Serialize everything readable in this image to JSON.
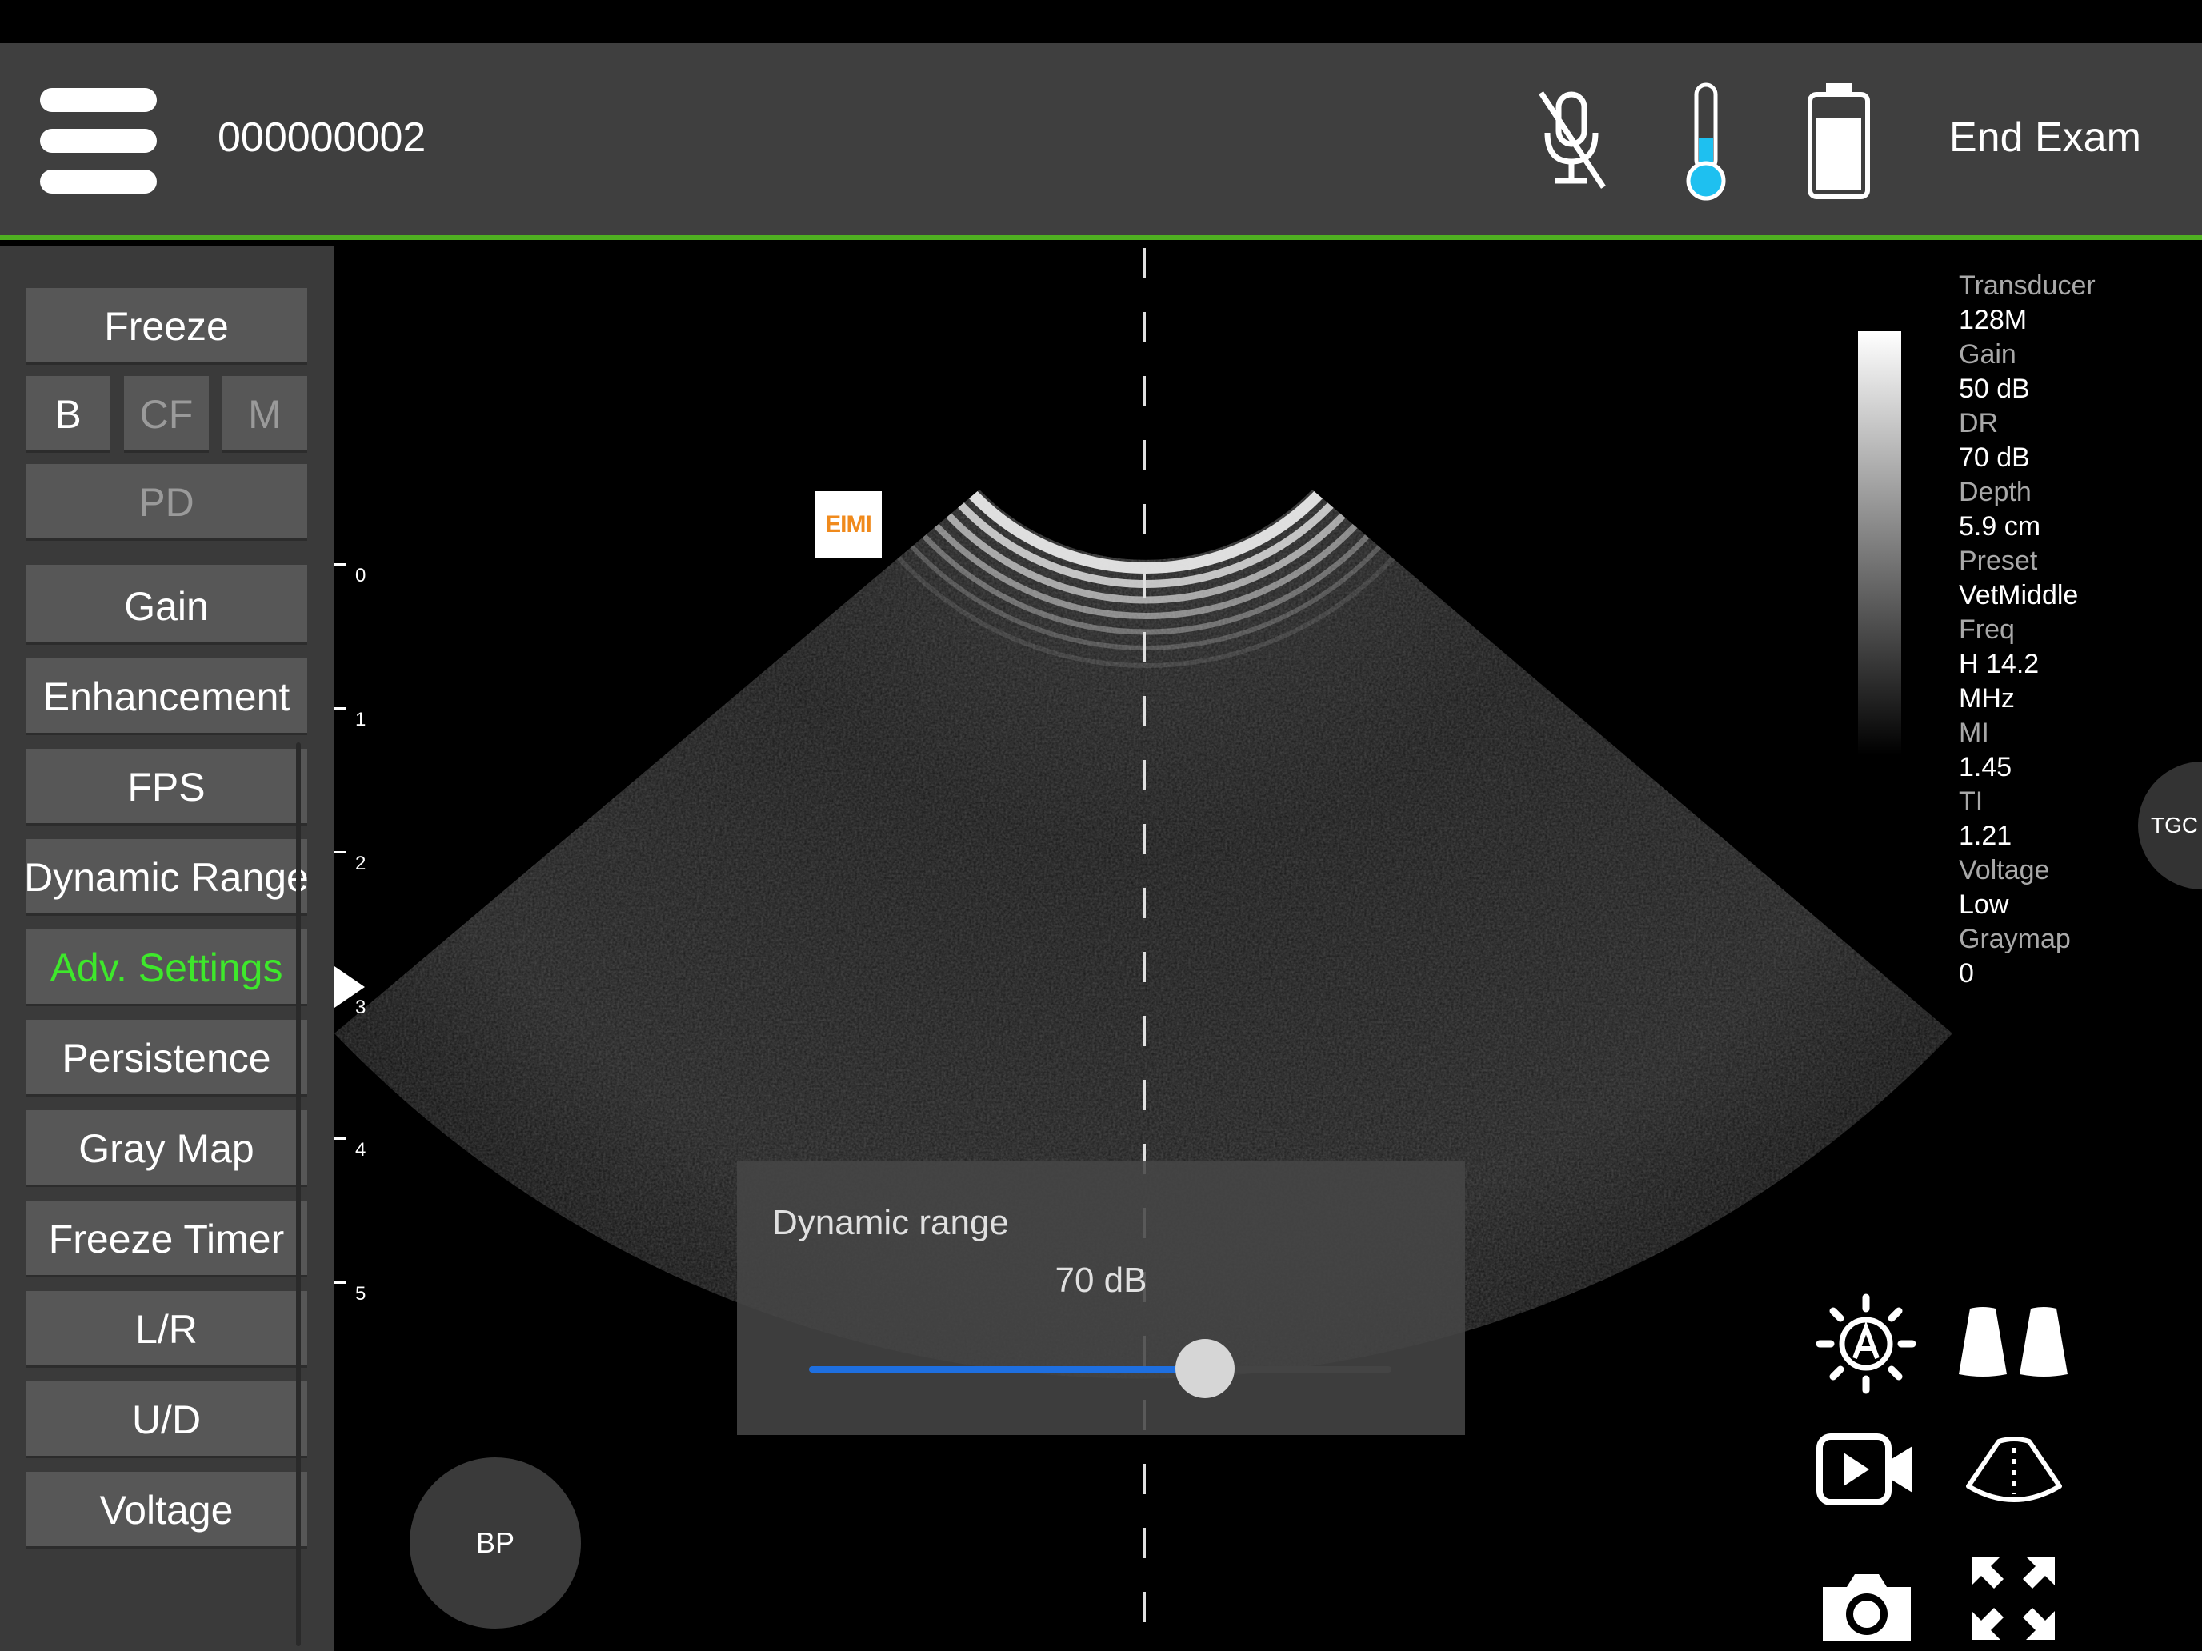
{
  "header": {
    "patient_id": "000000002",
    "end_exam_label": "End Exam"
  },
  "icons": {
    "menu": "hamburger-menu-icon",
    "mic": "microphone-muted-icon",
    "thermometer": "thermometer-icon",
    "battery": "battery-icon",
    "auto_brightness": "auto-brightness-icon",
    "dual_view": "dual-view-icon",
    "record": "video-record-icon",
    "sector": "sector-scan-icon",
    "camera": "camera-icon",
    "fullscreen": "fullscreen-expand-icon"
  },
  "colors": {
    "accent_green": "#3ee82b",
    "divider_green": "#4fb021",
    "thermo_fill": "#1ec0f0",
    "slider_blue": "#1e6fe0"
  },
  "sidebar": {
    "freeze": "Freeze",
    "modes": [
      "B",
      "CF",
      "M"
    ],
    "pd": "PD",
    "items": [
      "Gain",
      "Enhancement",
      "FPS",
      "Dynamic Range",
      "Adv. Settings",
      "Persistence",
      "Gray Map",
      "Freeze Timer",
      "L/R",
      "U/D",
      "Voltage"
    ],
    "active_item": "Adv. Settings"
  },
  "depth_scale": [
    "0",
    "1",
    "2",
    "3",
    "4",
    "5"
  ],
  "logo_text": "EIMI",
  "info": {
    "transducer_label": "Transducer",
    "transducer_value": "128M",
    "gain_label": "Gain",
    "gain_value": "50 dB",
    "dr_label": "DR",
    "dr_value": "70 dB",
    "depth_label": "Depth",
    "depth_value": "5.9 cm",
    "preset_label": "Preset",
    "preset_value": "VetMiddle",
    "freq_label": "Freq",
    "freq_value": "H 14.2",
    "freq_unit": "MHz",
    "mi_label": "MI",
    "mi_value": "1.45",
    "ti_label": "TI",
    "ti_value": "1.21",
    "voltage_label": "Voltage",
    "voltage_value": "Low",
    "graymap_label": "Graymap",
    "graymap_value": "0"
  },
  "tgc_label": "TGC",
  "bp_label": "BP",
  "dynamic_range": {
    "title": "Dynamic range",
    "value_text": "70 dB",
    "fraction": 0.68
  }
}
